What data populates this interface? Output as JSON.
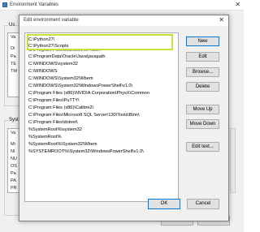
{
  "background_window": {
    "title": "Environment Variables",
    "close_glyph": "✕",
    "user_group_letters": [
      "Us"
    ],
    "user_list_letters": [
      "Va",
      "Oi",
      "Pa",
      "TE",
      "TM"
    ],
    "system_group_letters": [
      "Syste"
    ],
    "system_list_letters": [
      "Va",
      "Mi",
      "NI",
      "NU",
      "OS",
      "Pa",
      "PA",
      "PR"
    ],
    "buttons": {
      "ok": "OK",
      "cancel": "Cancel"
    }
  },
  "dialog": {
    "title": "Edit environment variable",
    "close_glyph": "✕",
    "entries": [
      "C:\\Python27\\",
      "C:\\Python27\\Scripts",
      "C:\\Program Files\\Microsoft MPI\\Bin\\",
      "C:\\ProgramData\\Oracle\\Java\\javapath",
      "C:\\WINDOWS\\system32",
      "C:\\WINDOWS",
      "C:\\WINDOWS\\System32\\Wbem",
      "C:\\WINDOWS\\System32\\WindowsPowerShell\\v1.0\\",
      "C:\\Program Files (x86)\\NVIDIA Corporation\\PhysX\\Common",
      "C:\\Program Files\\PuTTY\\",
      "C:\\Program Files (x86)\\Calibre2\\",
      "C:\\Program Files\\Microsoft SQL Server\\130\\Tools\\Binn\\",
      "C:\\Program Files\\dotnet\\",
      "%SystemRoot%\\system32",
      "%SystemRoot%",
      "%SystemRoot%\\System32\\Wbem",
      "%SYSTEMROOT%\\System32\\WindowsPowerShell\\v1.0\\"
    ],
    "side_buttons": {
      "new": "New",
      "edit": "Edit",
      "browse": "Browse...",
      "delete": "Delete",
      "move_up": "Move Up",
      "move_down": "Move Down",
      "edit_text": "Edit text..."
    },
    "footer": {
      "ok": "OK",
      "cancel": "Cancel"
    }
  },
  "colors": {
    "highlight_outline": "#c6e13d",
    "focus_border": "#0078d7"
  }
}
